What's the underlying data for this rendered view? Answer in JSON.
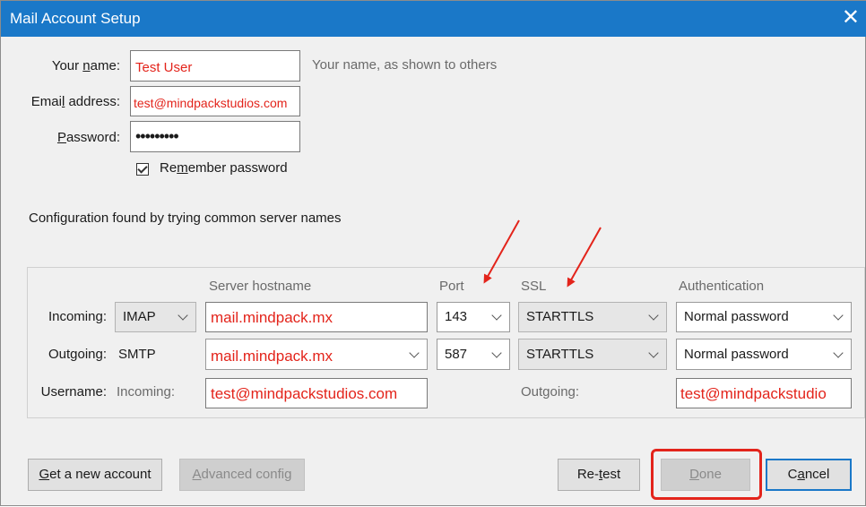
{
  "window": {
    "title": "Mail Account Setup"
  },
  "form": {
    "name_label_pre": "Your ",
    "name_label_u": "n",
    "name_label_post": "ame:",
    "name_value": "Test User",
    "name_hint": "Your name, as shown to others",
    "email_label_pre": "Emai",
    "email_label_u": "l",
    "email_label_post": " address:",
    "email_value": "test@mindpackstudios.com",
    "password_label_u": "P",
    "password_label_post": "assword:",
    "password_value": "•••••••••",
    "remember_pre": "Re",
    "remember_u": "m",
    "remember_post": "ember password",
    "remember_checked": true
  },
  "config_message": "Configuration found by trying common server names",
  "server_table": {
    "headers": {
      "hostname": "Server hostname",
      "port": "Port",
      "ssl": "SSL",
      "auth": "Authentication"
    },
    "incoming": {
      "label": "Incoming:",
      "protocol": "IMAP",
      "hostname": "mail.mindpack.mx",
      "port": "143",
      "ssl": "STARTTLS",
      "auth": "Normal password"
    },
    "outgoing": {
      "label": "Outgoing:",
      "protocol": "SMTP",
      "hostname": "mail.mindpack.mx",
      "port": "587",
      "ssl": "STARTTLS",
      "auth": "Normal password"
    },
    "username": {
      "label": "Username:",
      "incoming_label": "Incoming:",
      "incoming_value": "test@mindpackstudios.com",
      "outgoing_label": "Outgoing:",
      "outgoing_value": "test@mindpackstudio"
    }
  },
  "buttons": {
    "new_account_u": "G",
    "new_account_post": "et a new account",
    "advanced_u": "A",
    "advanced_post": "dvanced config",
    "retest_pre": "Re-",
    "retest_u": "t",
    "retest_post": "est",
    "done_u": "D",
    "done_post": "one",
    "cancel_pre": "C",
    "cancel_u": "a",
    "cancel_post": "ncel"
  },
  "colors": {
    "accent": "#1a78c8",
    "annotation_red": "#e3241b"
  }
}
